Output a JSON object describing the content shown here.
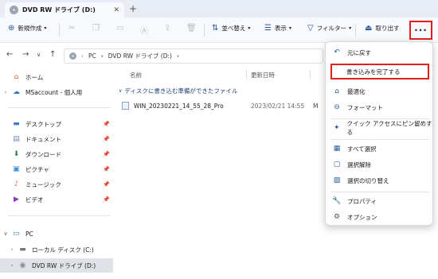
{
  "tab": {
    "title": "DVD RW ドライブ (D:)",
    "close": "✕",
    "new": "+"
  },
  "toolbar": {
    "new_label": "新規作成",
    "sort_label": "並べ替え",
    "view_label": "表示",
    "filter_label": "フィルター",
    "eject_label": "取り出す",
    "more_label": "···"
  },
  "address": {
    "segments": [
      "PC",
      "›",
      "DVD RW ドライブ (D:)",
      "›"
    ]
  },
  "sidebar": {
    "items": [
      {
        "label": "ホーム",
        "icon": "home-icon"
      },
      {
        "label": "MSaccount - 個人用",
        "icon": "cloud-icon"
      },
      {
        "label": "デスクトップ",
        "icon": "desktop-icon"
      },
      {
        "label": "ドキュメント",
        "icon": "documents-icon"
      },
      {
        "label": "ダウンロード",
        "icon": "download-icon"
      },
      {
        "label": "ピクチャ",
        "icon": "pictures-icon"
      },
      {
        "label": "ミュージック",
        "icon": "music-icon"
      },
      {
        "label": "ビデオ",
        "icon": "video-icon"
      },
      {
        "label": "PC",
        "icon": "pc-icon"
      },
      {
        "label": "ローカル ディスク (C:)",
        "icon": "drive-icon"
      },
      {
        "label": "DVD RW ドライブ (D:)",
        "icon": "dvd-icon"
      }
    ]
  },
  "columns": {
    "name": "名前",
    "modified": "更新日時"
  },
  "group": {
    "label": "ディスクに書き込む準備ができたファイル"
  },
  "file": {
    "name": "WIN_20230221_14_55_28_Pro",
    "date": "2023/02/21 14:55",
    "type": "M"
  },
  "menu": {
    "undo": "元に戻す",
    "finish_burning": "書き込みを完了する",
    "optimize": "最適化",
    "format": "フォーマット",
    "pin_quick": "クイック アクセスにピン留めする",
    "select_all": "すべて選択",
    "select_none": "選択解除",
    "invert": "選択の切り替え",
    "properties": "プロパティ",
    "options": "オプション"
  },
  "colors": {
    "highlight": "#e02020",
    "accent": "#2a5a9a"
  }
}
